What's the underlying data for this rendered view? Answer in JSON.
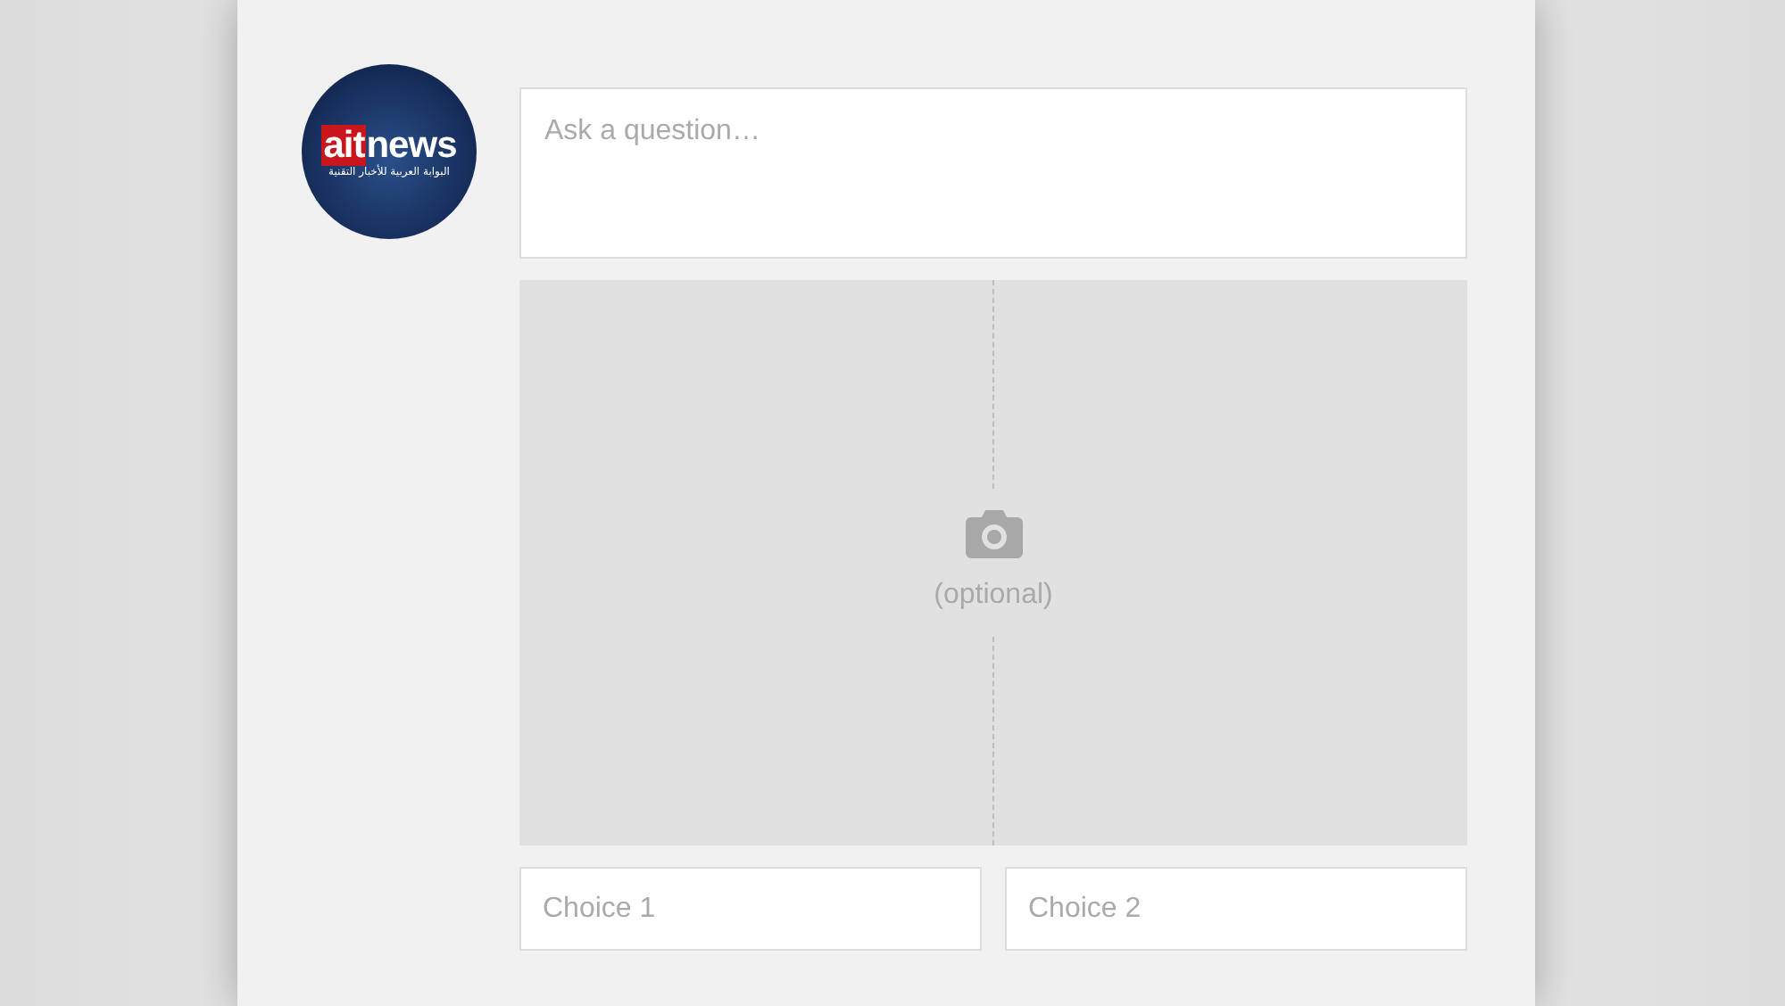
{
  "logo": {
    "wordmark": [
      {
        "text": "ait",
        "kind": "highlight"
      },
      {
        "text": "news",
        "kind": "plain"
      }
    ],
    "tagline": "البوابة العربية للأخبار التقنية"
  },
  "question": {
    "placeholder": "Ask a question…"
  },
  "photo": {
    "hint": "(optional)"
  },
  "choices": [
    {
      "placeholder": "Choice 1"
    },
    {
      "placeholder": "Choice 2"
    }
  ]
}
